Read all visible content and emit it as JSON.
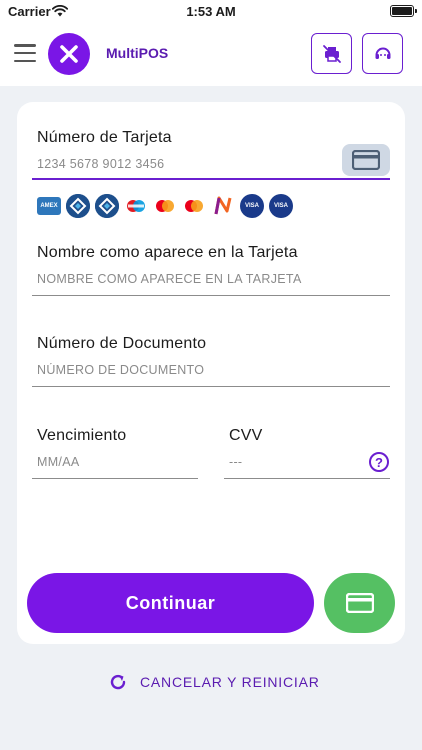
{
  "status_bar": {
    "carrier": "Carrier",
    "time": "1:53 AM"
  },
  "header": {
    "app_name": "MultiPOS"
  },
  "form": {
    "card_number": {
      "label": "Número de Tarjeta",
      "placeholder": "1234 5678 9012 3456",
      "value": ""
    },
    "brands": [
      {
        "name": "amex",
        "text": "AMEX"
      },
      {
        "name": "cabal",
        "text": ""
      },
      {
        "name": "cabal",
        "text": ""
      },
      {
        "name": "maestro",
        "text": ""
      },
      {
        "name": "mastercard",
        "text": ""
      },
      {
        "name": "mastercard",
        "text": ""
      },
      {
        "name": "naranja",
        "text": ""
      },
      {
        "name": "visa",
        "text": "VISA"
      },
      {
        "name": "visa",
        "text": "VISA"
      }
    ],
    "cardholder": {
      "label": "Nombre como aparece en la Tarjeta",
      "placeholder": "NOMBRE COMO APARECE EN LA TARJETA",
      "value": ""
    },
    "document": {
      "label": "Número de Documento",
      "placeholder": "NÚMERO DE DOCUMENTO",
      "value": ""
    },
    "expiry": {
      "label": "Vencimiento",
      "placeholder": "MM/AA",
      "value": ""
    },
    "cvv": {
      "label": "CVV",
      "placeholder": "---",
      "value": ""
    },
    "help_text": "?"
  },
  "actions": {
    "continue_label": "Continuar",
    "cancel_label": "CANCELAR Y REINICIAR"
  },
  "colors": {
    "primary": "#7a16e6",
    "primary_dark": "#5a1bb0",
    "success": "#55c063",
    "background": "#eef1f5"
  }
}
